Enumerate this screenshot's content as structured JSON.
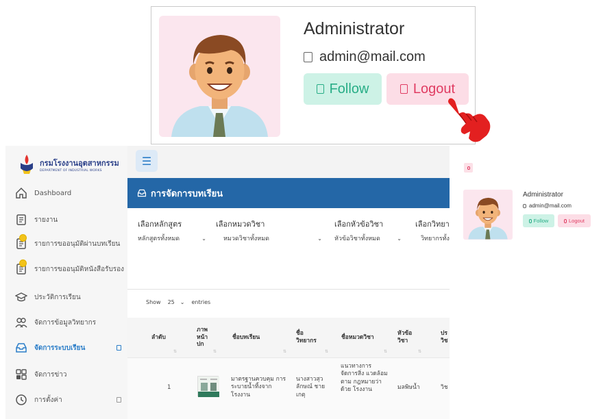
{
  "profile": {
    "name": "Administrator",
    "email": "admin@mail.com",
    "follow_label": "Follow",
    "logout_label": "Logout"
  },
  "logo": {
    "thai": "กรมโรงงานอุตสาหกรรม",
    "english": "DEPARTMENT OF INDUSTRIAL WORKS"
  },
  "sidebar": {
    "items": [
      {
        "label": "Dashboard",
        "icon": "home-icon"
      },
      {
        "label": "รายงาน",
        "icon": "document-icon"
      },
      {
        "label": "รายการขออนุมัติผ่านบทเรียน",
        "icon": "document-badge-icon"
      },
      {
        "label": "รายการขออนุมัติหนังสือรับรอง",
        "icon": "document-badge-icon"
      },
      {
        "label": "ประวัติการเรียน",
        "icon": "graduation-cap-icon"
      },
      {
        "label": "จัดการข้อมูลวิทยากร",
        "icon": "users-icon"
      },
      {
        "label": "จัดการระบบเรียน",
        "icon": "inbox-icon",
        "active": true
      },
      {
        "label": "จัดการข่าว",
        "icon": "grid-check-icon"
      },
      {
        "label": "การตั้งค่า",
        "icon": "clock-icon"
      }
    ]
  },
  "page": {
    "title": "การจัดการบทเรียน"
  },
  "filters": [
    {
      "label": "เลือกหลักสูตร",
      "value": "หลักสูตรทั้งหมด"
    },
    {
      "label": "เลือกหมวดวิชา",
      "value": "หมวดวิชาทั้งหมด"
    },
    {
      "label": "เลือกหัวข้อวิชา",
      "value": "หัวข้อวิชาทั้งหมด"
    },
    {
      "label": "เลือกวิทยา",
      "value": "วิทยากรทั้ง"
    }
  ],
  "table": {
    "show_label": "Show",
    "page_size": "25",
    "entries_label": "entries",
    "headers": [
      "ลำดับ",
      "ภาพ หน้า ปก",
      "ชื่อบทเรียน",
      "ชื่อ วิทยากร",
      "ชื่อหมวดวิชา",
      "หัวข้อ วิชา",
      "ปร วิช"
    ],
    "rows": [
      {
        "index": "1",
        "lesson": "มาตรฐานควบคุม การระบายน้ำทิ้งจาก โรงงาน",
        "instructor": "นางสาวสุว ลักษณ์ ชาย เกตุ",
        "category": "แนวทางการ จัดการสิ่ง แวดล้อมตาม กฎหมายว่าด้วย โรงงาน",
        "topic": "มลพิษน้ำ",
        "type": "วิช"
      }
    ]
  },
  "colors": {
    "primary": "#2467a7",
    "follow": "#27ad86",
    "logout": "#e03c62",
    "avatar_bg": "#fbe6ee"
  }
}
